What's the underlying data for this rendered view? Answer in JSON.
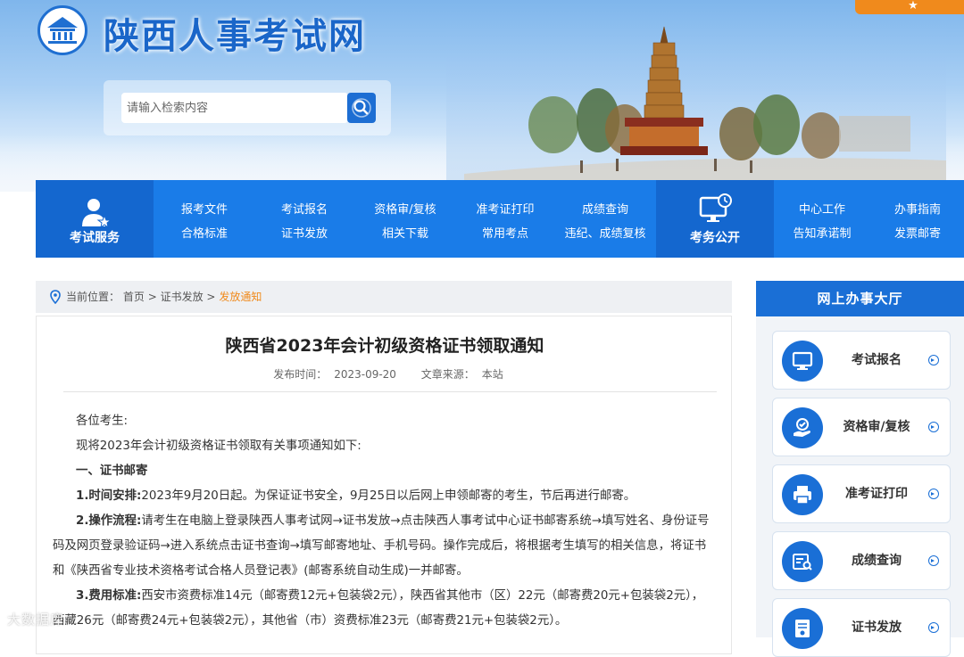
{
  "header": {
    "site_title": "陕西人事考试网",
    "top_button_label": "",
    "search": {
      "placeholder": "请输入检索内容",
      "value": ""
    }
  },
  "nav": {
    "exam_service": {
      "label": "考试服务"
    },
    "public_affairs": {
      "label": "考务公开"
    },
    "items": [
      {
        "top": "报考文件",
        "bottom": "合格标准"
      },
      {
        "top": "考试报名",
        "bottom": "证书发放"
      },
      {
        "top": "资格审/复核",
        "bottom": "相关下载"
      },
      {
        "top": "准考证打印",
        "bottom": "常用考点"
      },
      {
        "top": "成绩查询",
        "bottom": "违纪、成绩复核"
      }
    ],
    "right_items": [
      {
        "top": "中心工作",
        "bottom": "告知承诺制"
      },
      {
        "top": "办事指南",
        "bottom": "发票邮寄"
      }
    ]
  },
  "breadcrumb": {
    "prefix": "当前位置：",
    "home": "首页",
    "section": "证书发放",
    "current": "发放通知",
    "sep": ">"
  },
  "article": {
    "title": "陕西省2023年会计初级资格证书领取通知",
    "publish_label": "发布时间：",
    "publish_date": "2023-09-20",
    "source_label": "文章来源：",
    "source": "本站",
    "greeting": "各位考生:",
    "intro": "现将2023年会计初级资格证书领取有关事项通知如下:",
    "section1": "一、证书邮寄",
    "p1_label": "1.时间安排:",
    "p1_text": "2023年9月20日起。为保证证书安全，9月25日以后网上申领邮寄的考生，节后再进行邮寄。",
    "p2_label": "2.操作流程:",
    "p2_text": "请考生在电脑上登录陕西人事考试网→证书发放→点击陕西人事考试中心证书邮寄系统→填写姓名、身份证号码及网页登录验证码→进入系统点击证书查询→填写邮寄地址、手机号码。操作完成后，将根据考生填写的相关信息，将证书和《陕西省专业技术资格考试合格人员登记表》(邮寄系统自动生成)一并邮寄。",
    "p3_label": "3.费用标准:",
    "p3_text": "西安市资费标准14元（邮寄费12元+包装袋2元），陕西省其他市（区）22元（邮寄费20元+包装袋2元），西藏26元（邮寄费24元+包装袋2元），其他省（市）资费标准23元（邮寄费21元+包装袋2元）。"
  },
  "sidebar": {
    "title": "网上办事大厅",
    "cards": [
      {
        "label": "考试报名",
        "icon": "monitor-icon"
      },
      {
        "label": "资格审/复核",
        "icon": "hand-check-icon"
      },
      {
        "label": "准考证打印",
        "icon": "printer-icon"
      },
      {
        "label": "成绩查询",
        "icon": "score-search-icon"
      },
      {
        "label": "证书发放",
        "icon": "certificate-icon"
      }
    ]
  },
  "watermark": "大数据库",
  "colors": {
    "primary": "#1a7ce8",
    "primary_dark": "#1467cf",
    "accent_orange": "#f08a1c",
    "title_blue": "#1a66c9"
  }
}
